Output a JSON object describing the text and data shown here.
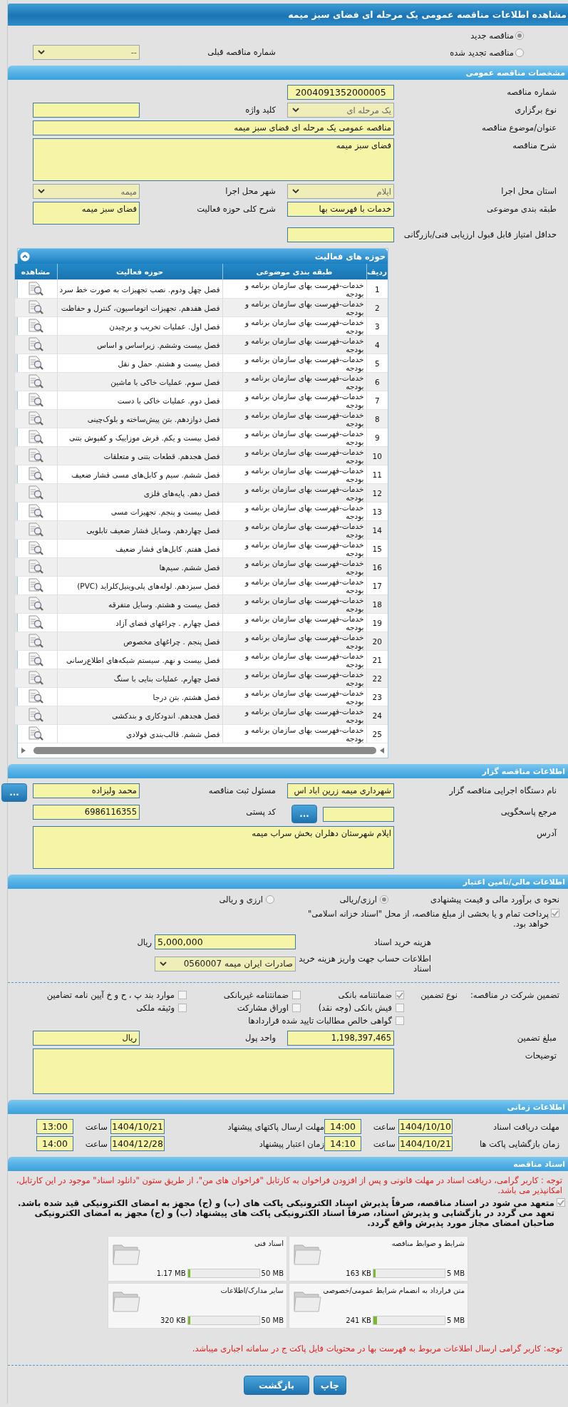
{
  "title": "مشاهده اطلاعات مناقصه عمومی یک مرحله ای فضای سبز میمه",
  "tender_type": [
    {
      "label": "مناقصه جدید",
      "selected": true
    },
    {
      "label": "مناقصه تجدید شده",
      "selected": false
    }
  ],
  "previous_number": {
    "label": "شماره مناقصه قبلی",
    "value": "--"
  },
  "general": {
    "title": "مشخصات مناقصه عمومی",
    "rows": [
      [
        {
          "label": "شماره مناقصه",
          "value": "2004091352000005",
          "kind": "number"
        }
      ],
      [
        {
          "label": "نوع برگزاری",
          "value": "یک مرحله ای",
          "kind": "select"
        },
        {
          "label": "کلید واژه",
          "kind": "text"
        }
      ],
      [
        {
          "label": "عنوان/موضوع مناقصه",
          "value": "مناقصه عمومی یک مرحله ای فضای سبز میمه",
          "kind": "wide"
        }
      ],
      [
        {
          "label": "شرح مناقصه",
          "value": "فضای سبز میمه",
          "kind": "textarea"
        }
      ],
      [
        {
          "label": "استان محل اجرا",
          "value": "ایلام",
          "kind": "select"
        },
        {
          "label": "شهر محل اجرا",
          "value": "میمه",
          "kind": "select"
        }
      ],
      [
        {
          "label": "طبقه بندی موضوعی",
          "value": "خدمات با فهرست بها",
          "kind": "text"
        },
        {
          "label": "شرح کلی حوزه فعالیت",
          "value": "فضای سبز میمه",
          "kind": "tall"
        }
      ],
      [
        {
          "label": "حداقل امتیاز قابل قبول ارزیابی فنی/بازرگانی",
          "kind": "text"
        }
      ]
    ]
  },
  "activities": {
    "title": "حوزه های فعالیت",
    "columns": [
      "ردیف",
      "طبقه بندی موضوعی",
      "حوزه فعالیت",
      "مشاهده"
    ],
    "rows": [
      {
        "row": "1",
        "category": "خدمات-فهرست بهای سازمان برنامه و بودجه",
        "activity": "فصل چهل ودوم. نصب تجهیزات به صورت خط سرد"
      },
      {
        "row": "2",
        "category": "خدمات-فهرست بهای سازمان برنامه و بودجه",
        "activity": "فصل هفدهم. تجهیزات اتوماسیون، کنترل و حفاظت"
      },
      {
        "row": "3",
        "category": "خدمات-فهرست بهای سازمان برنامه و بودجه",
        "activity": "فصل اول. عملیات تخریب و برچیدن"
      },
      {
        "row": "4",
        "category": "خدمات-فهرست بهای سازمان برنامه و بودجه",
        "activity": "فصل بیست وششم. زیراساس و اساس"
      },
      {
        "row": "5",
        "category": "خدمات-فهرست بهای سازمان برنامه و بودجه",
        "activity": "فصل بیست و هشتم. حمل و نقل"
      },
      {
        "row": "6",
        "category": "خدمات-فهرست بهای سازمان برنامه و بودجه",
        "activity": "فصل سوم. عملیات خاکی با ماشین"
      },
      {
        "row": "7",
        "category": "خدمات-فهرست بهای سازمان برنامه و بودجه",
        "activity": "فصل دوم. عملیات خاکی با دست"
      },
      {
        "row": "8",
        "category": "خدمات-فهرست بهای سازمان برنامه و بودجه",
        "activity": "فصل دوازدهم. بتن پیش‌ساخته و بلوک‌چینی"
      },
      {
        "row": "9",
        "category": "خدمات-فهرست بهای سازمان برنامه و بودجه",
        "activity": "فصل بیست و یکم. فرش موزاییک و کفپوش بتنی"
      },
      {
        "row": "10",
        "category": "خدمات-فهرست بهای سازمان برنامه و بودجه",
        "activity": "فصل هجدهم. قطعات بتنی و متعلقات"
      },
      {
        "row": "11",
        "category": "خدمات-فهرست بهای سازمان برنامه و بودجه",
        "activity": "فصل ششم. سیم و کابل‌های مسی فشار ضعیف"
      },
      {
        "row": "12",
        "category": "خدمات-فهرست بهای سازمان برنامه و بودجه",
        "activity": "فصل دهم. پایه‌های فلزی"
      },
      {
        "row": "13",
        "category": "خدمات-فهرست بهای سازمان برنامه و بودجه",
        "activity": "فصل بیست و پنجم. تجهیزات مسی"
      },
      {
        "row": "14",
        "category": "خدمات-فهرست بهای سازمان برنامه و بودجه",
        "activity": "فصل چهاردهم. وسایل فشار ضعیف تابلویی"
      },
      {
        "row": "15",
        "category": "خدمات-فهرست بهای سازمان برنامه و بودجه",
        "activity": "فصل هفتم. کابل‌های فشار ضعیف"
      },
      {
        "row": "16",
        "category": "خدمات-فهرست بهای سازمان برنامه و بودجه",
        "activity": "فصل ششم. سیم‌ها"
      },
      {
        "row": "17",
        "category": "خدمات-فهرست بهای سازمان برنامه و بودجه",
        "activity": "فصل سیزدهم. لوله‌های پلی‌وینیل‌کلراید (PVC)"
      },
      {
        "row": "18",
        "category": "خدمات-فهرست بهای سازمان برنامه و بودجه",
        "activity": "فصل بیست و هشتم. وسایل متفرقه"
      },
      {
        "row": "19",
        "category": "خدمات-فهرست بهای سازمان برنامه و بودجه",
        "activity": "فصل چهارم . چراغهای فضای آزاد"
      },
      {
        "row": "20",
        "category": "خدمات-فهرست بهای سازمان برنامه و بودجه",
        "activity": "فصل پنجم . چراغهای مخصوص"
      },
      {
        "row": "21",
        "category": "خدمات-فهرست بهای سازمان برنامه و بودجه",
        "activity": "فصل بیست و نهم. سیستم شبکه‌های اطلاع‌رسانی"
      },
      {
        "row": "22",
        "category": "خدمات-فهرست بهای سازمان برنامه و بودجه",
        "activity": "فصل چهارم. عملیات بنایی با سنگ"
      },
      {
        "row": "23",
        "category": "خدمات-فهرست بهای سازمان برنامه و بودجه",
        "activity": "فصل هشتم. بتن درجا"
      },
      {
        "row": "24",
        "category": "خدمات-فهرست بهای سازمان برنامه و بودجه",
        "activity": "فصل هجدهم. اندودکاری و بندکشی"
      },
      {
        "row": "25",
        "category": "خدمات-فهرست بهای سازمان برنامه و بودجه",
        "activity": "فصل ششم. قالب‌بندی فولادی"
      }
    ]
  },
  "organizer": {
    "title": "اطلاعات مناقصه گزار",
    "rows": [
      [
        {
          "label": "نام دستگاه اجرایی مناقصه گزار",
          "value": "شهرداری میمه زرین اباد اس",
          "kind": "text"
        },
        {
          "label": "مسئول ثبت مناقصه",
          "value": "محمد ولیزاده",
          "kind": "text",
          "button": "..."
        }
      ],
      [
        {
          "label": "مرجع پاسخگویی",
          "kind": "text",
          "button": "..."
        },
        {
          "label": "کد پستی",
          "value": "6986116355",
          "kind": "text"
        }
      ],
      [
        {
          "label": "آدرس",
          "value": "ایلام شهرستان دهلران بخش سراب میمه",
          "kind": "textarea"
        }
      ]
    ]
  },
  "finance": {
    "title": "اطلاعات مالی/تامین اعتبار",
    "estimate": {
      "label": "نحوه ی برآورد مالی و قیمت پیشنهادی",
      "options": [
        {
          "label": "ارزی/ریالی",
          "selected": true
        },
        {
          "label": "ارزی و ریالی",
          "selected": false
        }
      ]
    },
    "treasury": {
      "label": "پرداخت تمام و یا بخشی از مبلغ مناقصه، از محل \"اسناد خزانه اسلامی\" خواهد بود.",
      "checked": true
    },
    "doc_fee": {
      "label": "هزینه خرید اسناد",
      "value": "5,000,000",
      "unit": "ریال"
    },
    "account": {
      "label": "اطلاعات حساب جهت واریز هزینه خرید اسناد",
      "value": "صادرات ایران میمه 0560007"
    },
    "guarantee": {
      "label": "تضمین شرکت در مناقصه:",
      "type_label": "نوع تضمین",
      "options": [
        {
          "label": "ضمانتنامه بانکی",
          "checked": true
        },
        {
          "label": "ضمانتنامه غیربانکی",
          "checked": false
        },
        {
          "label": "موارد بند پ ، ح و خ آیین نامه تضامین",
          "checked": false
        },
        {
          "label": "فیش بانکی (وجه نقد)",
          "checked": false
        },
        {
          "label": "اوراق مشارکت",
          "checked": false
        },
        {
          "label": "وثیقه ملکی",
          "checked": false
        },
        {
          "label": "گواهی خالص مطالبات تایید شده قراردادها",
          "checked": false
        }
      ]
    },
    "rows": [
      [
        {
          "label": "مبلغ تضمین",
          "value": "1,198,397,465",
          "kind": "text"
        },
        {
          "label": "واحد پول",
          "value": "ریال",
          "kind": "text"
        }
      ],
      [
        {
          "label": "توضیحات",
          "kind": "textarea"
        }
      ]
    ]
  },
  "timing": {
    "title": "اطلاعات زمانی",
    "items": [
      {
        "label": "مهلت دریافت اسناد",
        "date": "1404/10/10",
        "time_label": "ساعت",
        "time": "14:00"
      },
      {
        "label": "مهلت ارسال پاکتهای پیشنهاد",
        "date": "1404/10/21",
        "time_label": "ساعت",
        "time": "13:00"
      },
      {
        "label": "زمان بازگشایی پاکت ها",
        "date": "1404/10/21",
        "time_label": "ساعت",
        "time": "14:10"
      },
      {
        "label": "زمان اعتبار پیشنهاد",
        "date": "1404/12/28",
        "time_label": "ساعت",
        "time": "14:00"
      }
    ]
  },
  "documents": {
    "title": "اسناد مناقصه",
    "notice": "توجه : کاربر گرامی، دریافت اسناد در مهلت قانونی و پس از افزودن فراخوان به کارتابل \"فراخوان های من\"، از طریق ستون \"دانلود اسناد\" موجود در این کارتابل، امکانپذیر می باشد.",
    "commitment": {
      "text": "متعهد می شود در اسناد مناقصه، صرفاً پذیرش اسناد الکترونیکی پاکت های (ب) و (ج) مجهز به امضای الکترونیکی قید شده باشد. تعهد می گردد در بازگشایی و پذیرش اسناد، صرفاً اسناد الکترونیکی پاکت های پیشنهاد (ب) و (ج) مجهز به امضای الکترونیکی صاحبان امضای مجاز مورد پذیرش واقع گردد.",
      "checked": true
    },
    "files": [
      {
        "title": "شرایط و ضوابط مناقصه",
        "size": "163 KB",
        "max": "5 MB",
        "level": 0.032
      },
      {
        "title": "اسناد فنی",
        "size": "1.17 MB",
        "max": "50 MB",
        "level": 0.023
      },
      {
        "title": "متن قرارداد به انضمام شرایط عمومی/خصوصی",
        "size": "241 KB",
        "max": "5 MB",
        "level": 0.047
      },
      {
        "title": "سایر مدارک/اطلاعات",
        "size": "320 KB",
        "max": "50 MB",
        "level": 0.006
      }
    ],
    "footer_note": "توجه: کاربر گرامی ارسال اطلاعات مربوط به فهرست بها در محتویات فایل پاکت ج در سامانه اجباری میباشد."
  },
  "buttons": [
    {
      "label": "چاپ"
    },
    {
      "label": "بازگشت"
    }
  ]
}
